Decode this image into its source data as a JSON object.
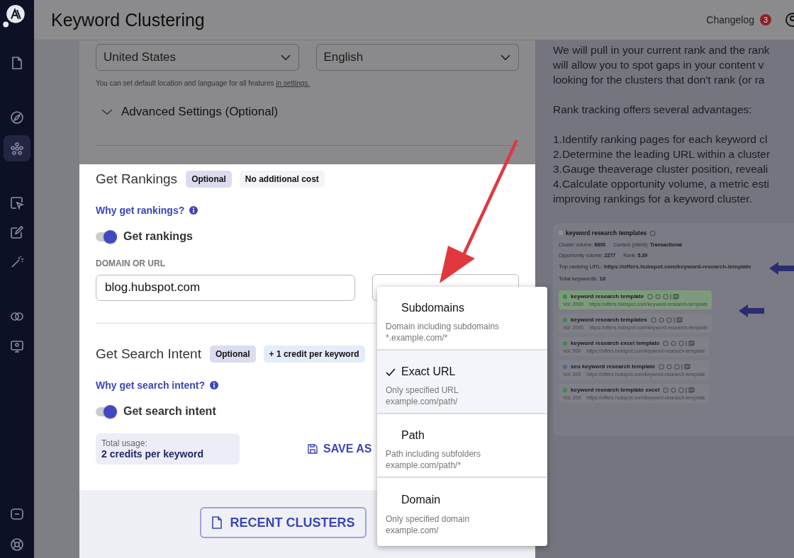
{
  "sidebar": {
    "items": [
      {
        "selected": false
      },
      {
        "selected": false
      },
      {
        "selected": true
      },
      {
        "selected": false
      },
      {
        "selected": false
      },
      {
        "selected": false
      },
      {
        "selected": false
      },
      {
        "selected": false
      },
      {
        "selected": false
      },
      {
        "selected": false
      }
    ]
  },
  "header": {
    "title": "Keyword Clustering",
    "changelog": "Changelog",
    "count": "3"
  },
  "location": {
    "country": "United States",
    "language": "English",
    "hint": "You can set default location and language for all features",
    "hint_link": "in settings."
  },
  "advanced": {
    "label": "Advanced Settings (Optional)",
    "expanded": false
  },
  "rankings": {
    "title": "Get Rankings",
    "badges": [
      {
        "text": "Optional",
        "kind": "optional"
      },
      {
        "text": "No additional cost",
        "kind": "free"
      }
    ],
    "link": "Why get rankings?",
    "toggle": {
      "label": "Get rankings",
      "on": true
    },
    "field_label": "DOMAIN OR URL",
    "domain": "blog.hubspot.com"
  },
  "intent": {
    "title": "Get Search Intent",
    "badges": [
      {
        "text": "Optional",
        "kind": "optional"
      },
      {
        "text": "+ 1 credit per keyword",
        "kind": "paid"
      }
    ],
    "link": "Why get search intent?",
    "toggle": {
      "label": "Get search intent",
      "on": true
    }
  },
  "usage": {
    "label": "Total usage:",
    "value": "2 credits per keyword"
  },
  "save_button": "SAVE AS",
  "recent_button": "RECENT CLUSTERS",
  "dropdown": {
    "options": [
      {
        "title": "Subdomains",
        "description": "Domain including subdomains",
        "example": "*.example.com/*",
        "selected": false
      },
      {
        "title": "Exact URL",
        "description": "Only specified URL",
        "example": "example.com/path/",
        "selected": true
      },
      {
        "title": "Path",
        "description": "Path including subfolders",
        "example": "example.com/path/*",
        "selected": false
      },
      {
        "title": "Domain",
        "description": "Only specified domain",
        "example": "example.com/",
        "selected": false
      }
    ]
  },
  "help": {
    "paragraphs": [
      [
        "We will pull in your current rank and the rank",
        "will allow you to spot gaps in your content v",
        "looking for the clusters that don't rank (or ra"
      ],
      [
        "Rank tracking offers several advantages:"
      ],
      [
        "1.Identify ranking pages for each keyword cl",
        "2.Determine the leading URL within a cluster",
        "3.Gauge theaverage cluster position, reveali",
        "4.Calculate opportunity volume, a metric esti",
        "improving rankings for a keyword cluster."
      ]
    ]
  },
  "example": {
    "title": "keyword research templates",
    "stats": [
      [
        {
          "label": "Cluster volume:",
          "value": "6600"
        },
        {
          "label": "Context (intent):",
          "value": "Transactional"
        }
      ],
      [
        {
          "label": "Opportunity volume:",
          "value": "2277"
        },
        {
          "label": "Rank:",
          "value": "5.39"
        }
      ]
    ],
    "top_url": {
      "label": "Top ranking URL:",
      "value": "https://offers.hubspot.com/keyword-research-template"
    },
    "total": {
      "label": "Total keywords:",
      "value": "18"
    },
    "keywords": [
      {
        "name": "keyword research template",
        "volume": "Vol: 2000",
        "url": "https://offers.hubspot.com/keyword-research-template",
        "highlighted": true,
        "color": "#3f8a4a"
      },
      {
        "name": "keyword research templates",
        "volume": "Vol: 2000",
        "url": "https://offers.hubspot.com/keyword-research-template",
        "highlighted": false,
        "color": "#3f8a4a"
      },
      {
        "name": "keyword research excel template",
        "volume": "Vol: 500",
        "url": "https://offers.hubspot.com/keyword-research-template",
        "highlighted": false,
        "color": "#3f8a4a"
      },
      {
        "name": "seo keyword research template",
        "volume": "Vol: 300",
        "url": "https://offers.hubspot.com/keyword-research-template",
        "highlighted": false,
        "color": "#4b6b9a"
      },
      {
        "name": "keyword research template excel",
        "volume": "Vol: 200",
        "url": "https://offers.hubspot.com/keyword-research-template",
        "highlighted": false,
        "color": "#3f8a4a"
      }
    ]
  }
}
